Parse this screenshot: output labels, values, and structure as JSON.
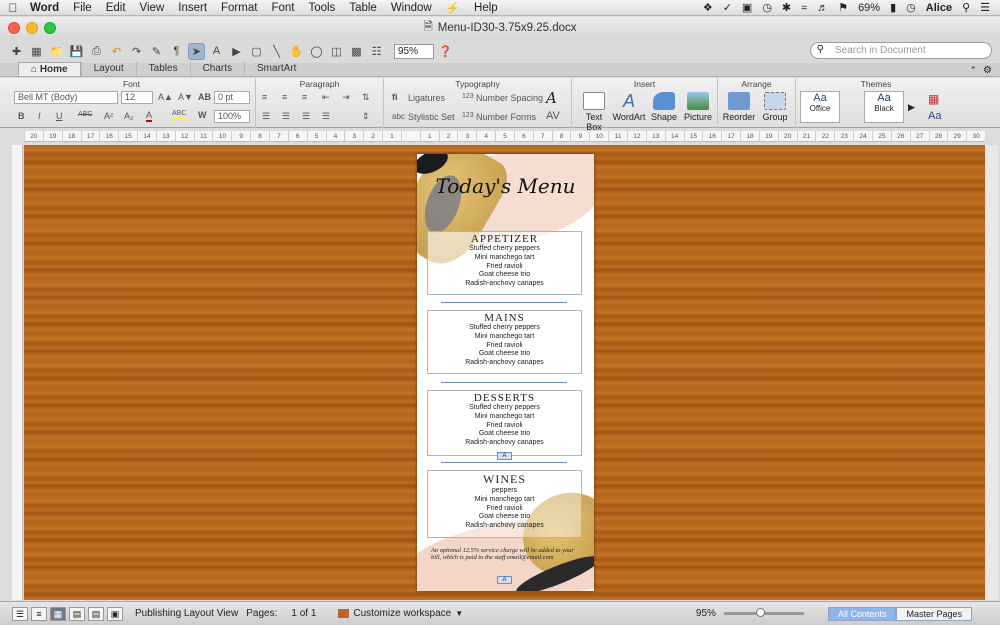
{
  "menubar": {
    "app": "Word",
    "items": [
      "File",
      "Edit",
      "View",
      "Insert",
      "Format",
      "Font",
      "Tools",
      "Table",
      "Window",
      "Help"
    ],
    "battery": "69%",
    "user": "Alice"
  },
  "window": {
    "title": "Menu-ID30-3.75x9.25.docx"
  },
  "toolbar": {
    "zoom": "95%",
    "search_placeholder": "Search in Document"
  },
  "tabs": [
    "Home",
    "Layout",
    "Tables",
    "Charts",
    "SmartArt"
  ],
  "ribbon": {
    "groups": [
      "Font",
      "Paragraph",
      "Typography",
      "Insert",
      "Arrange",
      "Themes"
    ],
    "font_name": "Bell MT (Body)",
    "font_size": "12",
    "spacing": "0 pt",
    "scale": "100%",
    "ligatures": "Ligatures",
    "number_spacing": "Number Spacing",
    "stylistic_set": "Stylistic Set",
    "number_forms": "Number Forms",
    "insert_items": [
      "Text Box",
      "WordArt",
      "Shape",
      "Picture"
    ],
    "arrange_items": [
      "Reorder",
      "Group"
    ],
    "themes": [
      "Office",
      "Black"
    ]
  },
  "ruler": {
    "ticks": [
      "20",
      "19",
      "18",
      "17",
      "16",
      "15",
      "14",
      "13",
      "12",
      "11",
      "10",
      "9",
      "8",
      "7",
      "6",
      "5",
      "4",
      "3",
      "2",
      "1",
      "",
      "1",
      "2",
      "3",
      "4",
      "5",
      "6",
      "7",
      "8",
      "9",
      "10",
      "11",
      "12",
      "13",
      "14",
      "15",
      "16",
      "17",
      "18",
      "19",
      "20",
      "21",
      "22",
      "23",
      "24",
      "25",
      "26",
      "27",
      "28",
      "29",
      "30"
    ]
  },
  "document": {
    "title": "Today's Menu",
    "sections": [
      {
        "heading": "APPETIZER",
        "items": [
          "Stuffed cherry peppers",
          "Mini manchego tart",
          "Fried ravioli",
          "Goat cheese trio",
          "Radish-anchovy canapes"
        ]
      },
      {
        "heading": "MAINS",
        "items": [
          "Stuffed cherry peppers",
          "Mini manchego tart",
          "Fried ravioli",
          "Goat cheese trio",
          "Radish-anchovy canapes"
        ]
      },
      {
        "heading": "DESSERTS",
        "items": [
          "Stuffed cherry peppers",
          "Mini manchego tart",
          "Fried ravioli",
          "Goat cheese trio",
          "Radish-anchovy canapes"
        ]
      },
      {
        "heading": "WINES",
        "items": [
          "peppers",
          "Mini manchego tart",
          "Fried ravioli",
          "Goat cheese trio",
          "Radish-anchovy canapes"
        ]
      }
    ],
    "footer_note": "An optional 12.5% service charge will be added to your bill, which is paid to the staff email@email.com",
    "anchor_label": "A"
  },
  "statusbar": {
    "view": "Publishing Layout View",
    "pages_label": "Pages:",
    "pages_value": "1 of 1",
    "workspace": "Customize workspace",
    "zoom": "95%",
    "all_contents": "All Contents",
    "master_pages": "Master Pages"
  },
  "colors": {
    "accent": "#6d8fbd",
    "wood": "#b5651d",
    "gold": "#c9a24a"
  }
}
